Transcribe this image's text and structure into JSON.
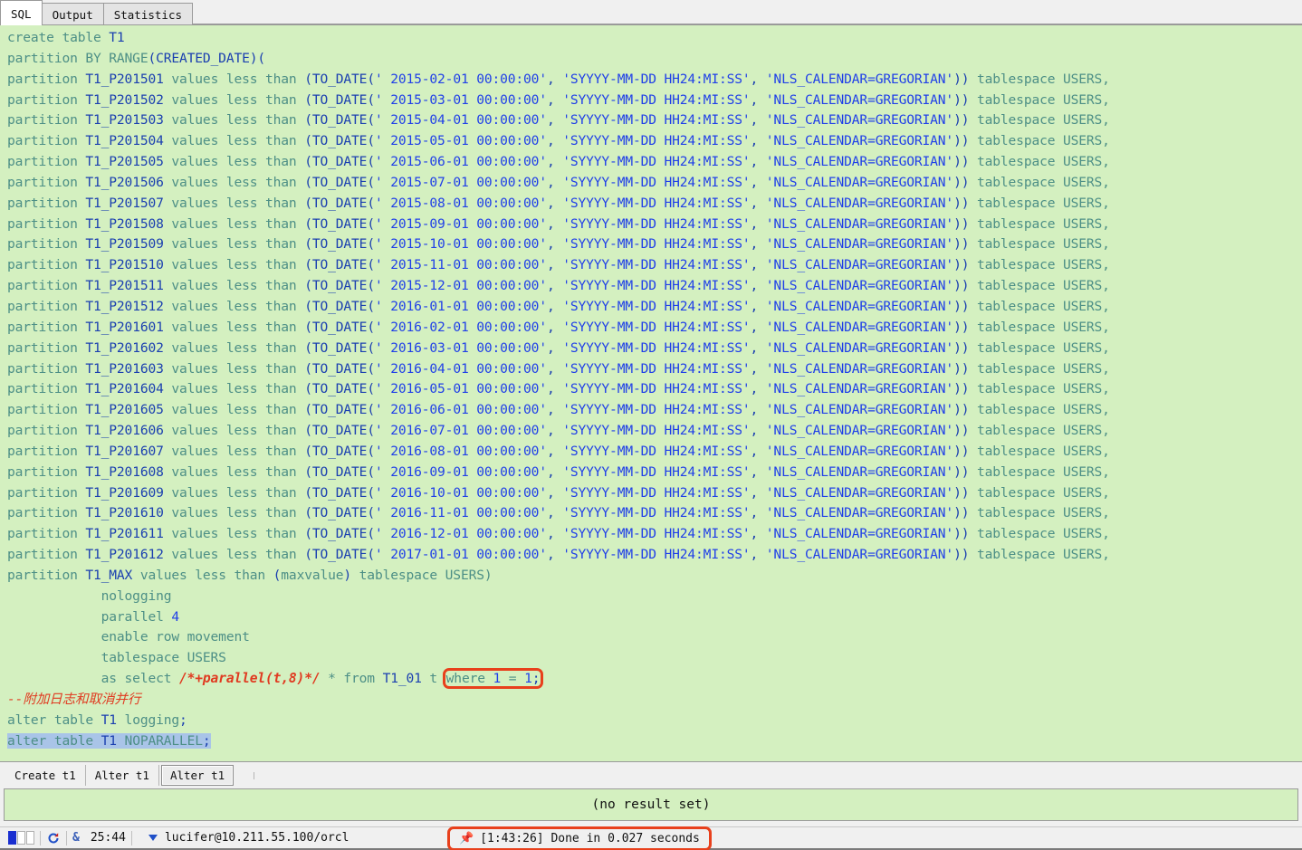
{
  "window": {
    "top_tabs": [
      {
        "label": "SQL",
        "active": true
      },
      {
        "label": "Output",
        "active": false
      },
      {
        "label": "Statistics",
        "active": false
      }
    ]
  },
  "editor": {
    "theme": {
      "background": "#d4f0c0",
      "keyword_color": "#4d8f86",
      "identifier_color": "#1a3fb0",
      "string_color": "#2040e8",
      "comment_color": "#e03a20",
      "selection_color": "#a9c4e8",
      "highlight_box_color": "#e8401c"
    },
    "lines": [
      {
        "id": "l1",
        "text": "create table T1"
      },
      {
        "id": "l2",
        "text": "partition BY RANGE(CREATED_DATE)("
      },
      {
        "id": "l3",
        "text": "partition T1_P201501 values less than (TO_DATE(' 2015-02-01 00:00:00', 'SYYYY-MM-DD HH24:MI:SS', 'NLS_CALENDAR=GREGORIAN')) tablespace USERS,"
      },
      {
        "id": "l4",
        "text": "partition T1_P201502 values less than (TO_DATE(' 2015-03-01 00:00:00', 'SYYYY-MM-DD HH24:MI:SS', 'NLS_CALENDAR=GREGORIAN')) tablespace USERS,"
      },
      {
        "id": "l5",
        "text": "partition T1_P201503 values less than (TO_DATE(' 2015-04-01 00:00:00', 'SYYYY-MM-DD HH24:MI:SS', 'NLS_CALENDAR=GREGORIAN')) tablespace USERS,"
      },
      {
        "id": "l6",
        "text": "partition T1_P201504 values less than (TO_DATE(' 2015-05-01 00:00:00', 'SYYYY-MM-DD HH24:MI:SS', 'NLS_CALENDAR=GREGORIAN')) tablespace USERS,"
      },
      {
        "id": "l7",
        "text": "partition T1_P201505 values less than (TO_DATE(' 2015-06-01 00:00:00', 'SYYYY-MM-DD HH24:MI:SS', 'NLS_CALENDAR=GREGORIAN')) tablespace USERS,"
      },
      {
        "id": "l8",
        "text": "partition T1_P201506 values less than (TO_DATE(' 2015-07-01 00:00:00', 'SYYYY-MM-DD HH24:MI:SS', 'NLS_CALENDAR=GREGORIAN')) tablespace USERS,"
      },
      {
        "id": "l9",
        "text": "partition T1_P201507 values less than (TO_DATE(' 2015-08-01 00:00:00', 'SYYYY-MM-DD HH24:MI:SS', 'NLS_CALENDAR=GREGORIAN')) tablespace USERS,"
      },
      {
        "id": "l10",
        "text": "partition T1_P201508 values less than (TO_DATE(' 2015-09-01 00:00:00', 'SYYYY-MM-DD HH24:MI:SS', 'NLS_CALENDAR=GREGORIAN')) tablespace USERS,"
      },
      {
        "id": "l11",
        "text": "partition T1_P201509 values less than (TO_DATE(' 2015-10-01 00:00:00', 'SYYYY-MM-DD HH24:MI:SS', 'NLS_CALENDAR=GREGORIAN')) tablespace USERS,"
      },
      {
        "id": "l12",
        "text": "partition T1_P201510 values less than (TO_DATE(' 2015-11-01 00:00:00', 'SYYYY-MM-DD HH24:MI:SS', 'NLS_CALENDAR=GREGORIAN')) tablespace USERS,"
      },
      {
        "id": "l13",
        "text": "partition T1_P201511 values less than (TO_DATE(' 2015-12-01 00:00:00', 'SYYYY-MM-DD HH24:MI:SS', 'NLS_CALENDAR=GREGORIAN')) tablespace USERS,"
      },
      {
        "id": "l14",
        "text": "partition T1_P201512 values less than (TO_DATE(' 2016-01-01 00:00:00', 'SYYYY-MM-DD HH24:MI:SS', 'NLS_CALENDAR=GREGORIAN')) tablespace USERS,"
      },
      {
        "id": "l15",
        "text": "partition T1_P201601 values less than (TO_DATE(' 2016-02-01 00:00:00', 'SYYYY-MM-DD HH24:MI:SS', 'NLS_CALENDAR=GREGORIAN')) tablespace USERS,"
      },
      {
        "id": "l16",
        "text": "partition T1_P201602 values less than (TO_DATE(' 2016-03-01 00:00:00', 'SYYYY-MM-DD HH24:MI:SS', 'NLS_CALENDAR=GREGORIAN')) tablespace USERS,"
      },
      {
        "id": "l17",
        "text": "partition T1_P201603 values less than (TO_DATE(' 2016-04-01 00:00:00', 'SYYYY-MM-DD HH24:MI:SS', 'NLS_CALENDAR=GREGORIAN')) tablespace USERS,"
      },
      {
        "id": "l18",
        "text": "partition T1_P201604 values less than (TO_DATE(' 2016-05-01 00:00:00', 'SYYYY-MM-DD HH24:MI:SS', 'NLS_CALENDAR=GREGORIAN')) tablespace USERS,"
      },
      {
        "id": "l19",
        "text": "partition T1_P201605 values less than (TO_DATE(' 2016-06-01 00:00:00', 'SYYYY-MM-DD HH24:MI:SS', 'NLS_CALENDAR=GREGORIAN')) tablespace USERS,"
      },
      {
        "id": "l20",
        "text": "partition T1_P201606 values less than (TO_DATE(' 2016-07-01 00:00:00', 'SYYYY-MM-DD HH24:MI:SS', 'NLS_CALENDAR=GREGORIAN')) tablespace USERS,"
      },
      {
        "id": "l21",
        "text": "partition T1_P201607 values less than (TO_DATE(' 2016-08-01 00:00:00', 'SYYYY-MM-DD HH24:MI:SS', 'NLS_CALENDAR=GREGORIAN')) tablespace USERS,"
      },
      {
        "id": "l22",
        "text": "partition T1_P201608 values less than (TO_DATE(' 2016-09-01 00:00:00', 'SYYYY-MM-DD HH24:MI:SS', 'NLS_CALENDAR=GREGORIAN')) tablespace USERS,"
      },
      {
        "id": "l23",
        "text": "partition T1_P201609 values less than (TO_DATE(' 2016-10-01 00:00:00', 'SYYYY-MM-DD HH24:MI:SS', 'NLS_CALENDAR=GREGORIAN')) tablespace USERS,"
      },
      {
        "id": "l24",
        "text": "partition T1_P201610 values less than (TO_DATE(' 2016-11-01 00:00:00', 'SYYYY-MM-DD HH24:MI:SS', 'NLS_CALENDAR=GREGORIAN')) tablespace USERS,"
      },
      {
        "id": "l25",
        "text": "partition T1_P201611 values less than (TO_DATE(' 2016-12-01 00:00:00', 'SYYYY-MM-DD HH24:MI:SS', 'NLS_CALENDAR=GREGORIAN')) tablespace USERS,"
      },
      {
        "id": "l26",
        "text": "partition T1_P201612 values less than (TO_DATE(' 2017-01-01 00:00:00', 'SYYYY-MM-DD HH24:MI:SS', 'NLS_CALENDAR=GREGORIAN')) tablespace USERS,"
      },
      {
        "id": "l27",
        "text": "partition T1_MAX values less than (maxvalue) tablespace USERS)"
      },
      {
        "id": "l28",
        "text": "            nologging"
      },
      {
        "id": "l29",
        "text": "            parallel 4"
      },
      {
        "id": "l30",
        "text": "            enable row movement"
      },
      {
        "id": "l31",
        "text": "            tablespace USERS"
      },
      {
        "id": "l32",
        "text": "            as select /*+parallel(t,8)*/ * from T1_01 t where 1 = 1;"
      },
      {
        "id": "l33",
        "text": "--附加日志和取消并行"
      },
      {
        "id": "l34",
        "text": "alter table T1 logging;"
      },
      {
        "id": "l35",
        "text": "alter table T1 NOPARALLEL;"
      }
    ],
    "segments": {
      "l1": {
        "kw1": "create table ",
        "id1": "T1"
      },
      "l2": {
        "kw1": "partition BY RANGE",
        "p1": "(",
        "id1": "CREATED_DATE",
        "p2": "("
      },
      "part_pre": "partition ",
      "part_mid": " values less than ",
      "part_open": "(TO_DATE(",
      "part_close": ")) ",
      "part_tail": "tablespace USERS,",
      "fmt_mask": "'SYYYY-MM-DD HH24:MI:SS'",
      "nls": "'NLS_CALENDAR=GREGORIAN'",
      "maxline": {
        "pre": "partition ",
        "id": "T1_MAX",
        "mid": " values less than ",
        "open": "(",
        "val": "maxvalue",
        "close": ") ",
        "tail": "tablespace USERS)"
      },
      "nologging": "nologging",
      "parallel_kw": "parallel ",
      "parallel_val": "4",
      "enable_row": "enable row movement",
      "tablespace_users": "tablespace USERS",
      "as_select": "as select ",
      "hint": "/*+parallel(t,8)*/",
      "star_from": " * from ",
      "t101": "T1_01",
      "alias": " t ",
      "where_clause": "where 1 = 1;",
      "comment_cn": "--附加日志和取消并行",
      "alter_logging_kw": "alter table ",
      "alter_logging_id": "T1",
      "alter_logging_tail": " logging;",
      "alter_np_kw": "alter table ",
      "alter_np_id": "T1",
      "alter_np_tail": " NOPARALLEL",
      "semicolon": ";"
    }
  },
  "result_tabs": [
    {
      "label": "Create t1",
      "active": false
    },
    {
      "label": "Alter t1",
      "active": false
    },
    {
      "label": "Alter t1",
      "active": true
    }
  ],
  "result": {
    "message": "(no result set)"
  },
  "statusbar": {
    "cursor_position": "25:44",
    "connection": "lucifer@10.211.55.100/orcl",
    "execution_message": "[1:43:26]  Done in 0.027 seconds",
    "pin_icon": "📌"
  }
}
